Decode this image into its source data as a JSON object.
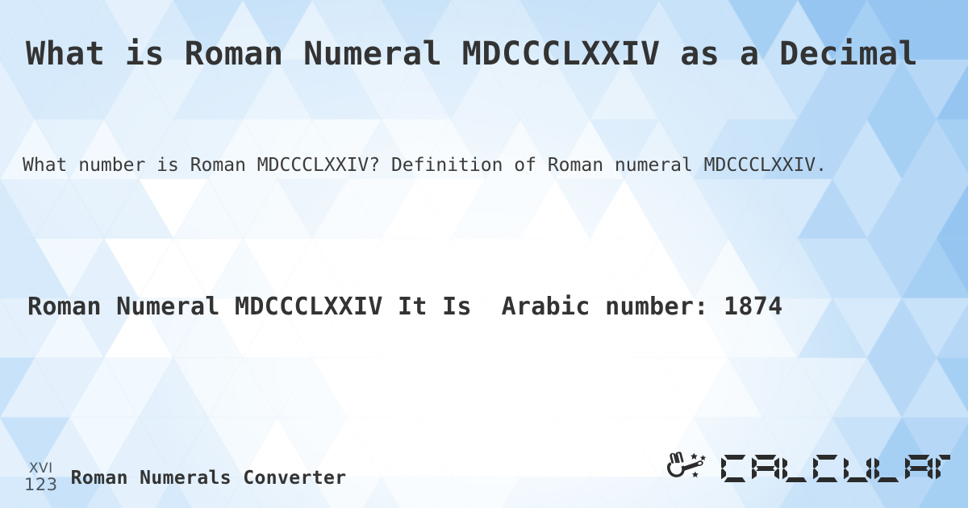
{
  "page": {
    "title": "What is Roman Numeral MDCCCLXXIV as a Decimal",
    "subtitle": "What number is Roman MDCCCLXXIV? Definition of Roman numeral MDCCCLXXIV.",
    "result_text": "Roman Numeral MDCCCLXXIV It Is  Arabic number: 1874",
    "roman_numeral": "MDCCCLXXIV",
    "arabic_number": "1874"
  },
  "footer": {
    "logo": {
      "top_text": "XVI",
      "bottom_text": "123",
      "color": "#4a5560"
    },
    "site_label": "Roman Numerals Converter",
    "brand": {
      "wordmark": "CALCULAT.IO",
      "icon": "hand-magic-wand-icon",
      "color": "#2b2b2b"
    }
  },
  "theme": {
    "background_base": "#bcdcf7",
    "background_light": "#ffffff",
    "background_mid": "#d6eafb",
    "background_deep": "#a8d2f5",
    "text_color": "#333333",
    "subtitle_color": "#3b3b3b"
  },
  "background": {
    "pattern": "low-poly-triangles",
    "triangle_size": 86,
    "palette": [
      "#ffffff",
      "#f2f9fe",
      "#e4f1fc",
      "#d6eafb",
      "#c7e2f9",
      "#b6d8f6",
      "#a6cff4",
      "#96c5f1"
    ]
  }
}
